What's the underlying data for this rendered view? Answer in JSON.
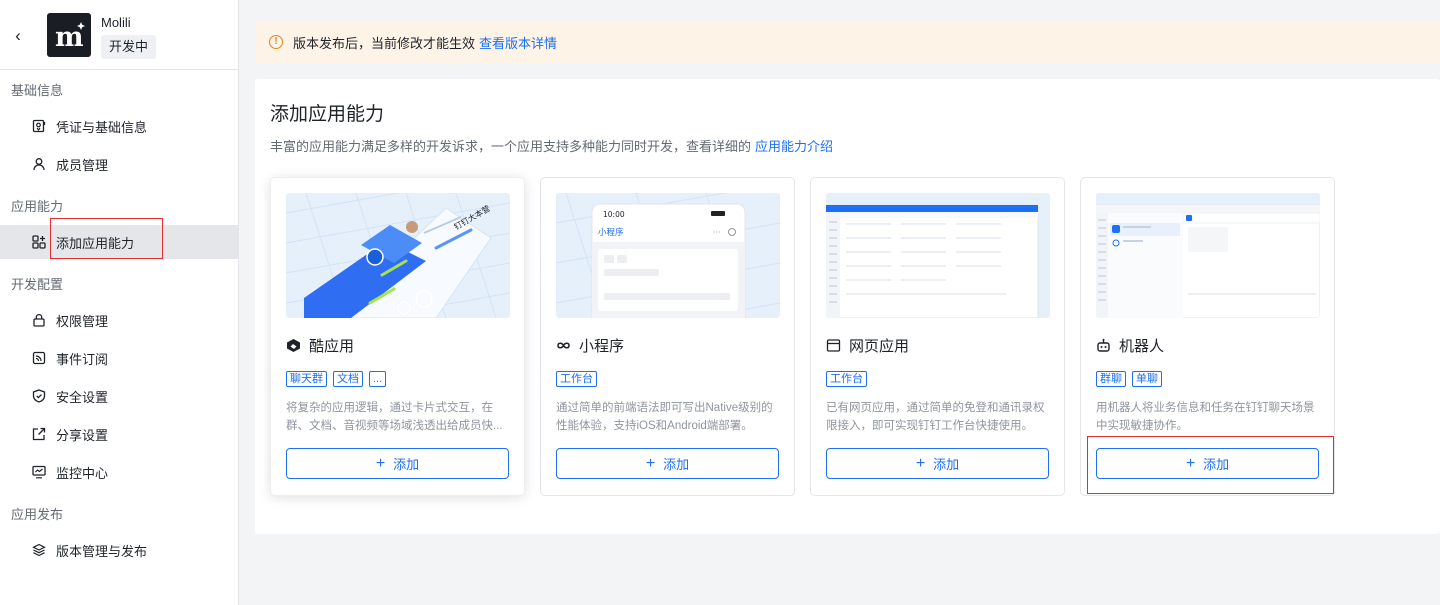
{
  "sidebar": {
    "app_name": "Molili",
    "status_badge": "开发中",
    "sections": {
      "basic": "基础信息",
      "capability": "应用能力",
      "dev_config": "开发配置",
      "publish": "应用发布"
    },
    "items": {
      "credentials": "凭证与基础信息",
      "members": "成员管理",
      "add_capability": "添加应用能力",
      "permissions": "权限管理",
      "events": "事件订阅",
      "security": "安全设置",
      "share": "分享设置",
      "monitor": "监控中心",
      "versions": "版本管理与发布"
    }
  },
  "notice": {
    "text": "版本发布后，当前修改才能生效",
    "link": "查看版本详情"
  },
  "panel": {
    "title": "添加应用能力",
    "desc": "丰富的应用能力满足多样的开发诉求，一个应用支持多种能力同时开发，查看详细的",
    "desc_link": "应用能力介绍"
  },
  "cards": [
    {
      "title": "酷应用",
      "tags": [
        "聊天群",
        "文档",
        "..."
      ],
      "desc": "将复杂的应用逻辑，通过卡片式交互，在群、文档、音视频等场域浅透出给成员快...",
      "button": "添加",
      "image_text": "钉钉大本营",
      "icon": "cool-app-icon"
    },
    {
      "title": "小程序",
      "tags": [
        "工作台"
      ],
      "desc": "通过简单的前端语法即可写出Native级别的性能体验，支持iOS和Android端部署。",
      "button": "添加",
      "image_time": "10:00",
      "image_title": "小程序",
      "icon": "mini-program-icon"
    },
    {
      "title": "网页应用",
      "tags": [
        "工作台"
      ],
      "desc": "已有网页应用，通过简单的免登和通讯录权限接入，即可实现钉钉工作台快捷使用。",
      "button": "添加",
      "icon": "web-app-icon"
    },
    {
      "title": "机器人",
      "tags": [
        "群聊",
        "单聊"
      ],
      "desc": "用机器人将业务信息和任务在钉钉聊天场景中实现敏捷协作。",
      "button": "添加",
      "icon": "robot-icon"
    }
  ],
  "colors": {
    "accent": "#1d6ff5",
    "highlight_box": "#e02f2f",
    "notice_bg": "#fdf3e6"
  }
}
